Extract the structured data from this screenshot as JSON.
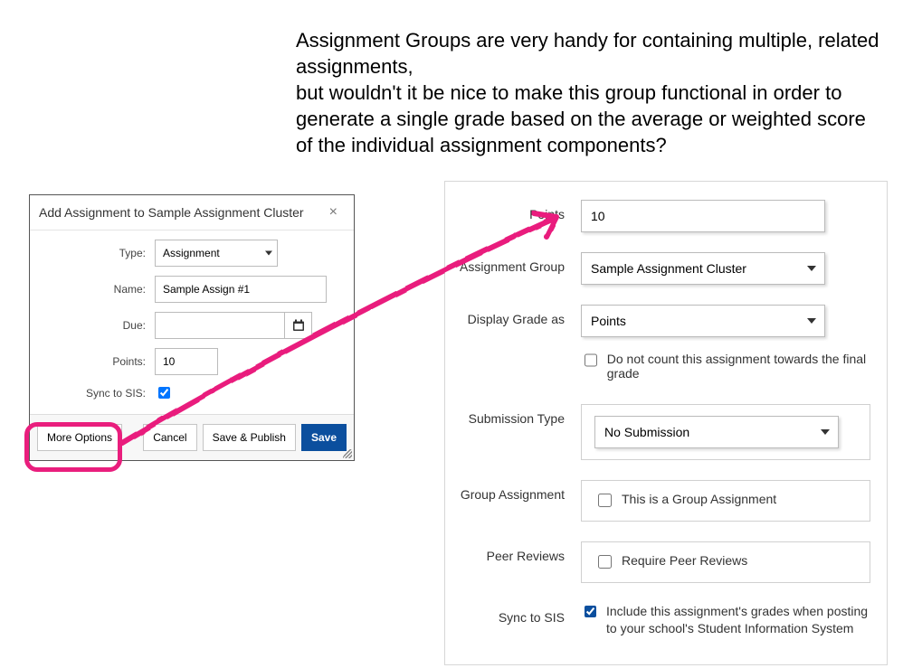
{
  "caption": {
    "line1": "Assignment Groups are very handy for containing multiple, related assignments,",
    "line2": "but wouldn't it be nice to make this group functional in order to generate a single grade based on the average or weighted score of the individual assignment components?"
  },
  "modal": {
    "title": "Add Assignment to Sample Assignment Cluster",
    "close_glyph": "×",
    "labels": {
      "type": "Type:",
      "name": "Name:",
      "due": "Due:",
      "points": "Points:",
      "sync": "Sync to SIS:"
    },
    "fields": {
      "type_value": "Assignment",
      "name_value": "Sample Assign #1",
      "due_value": "",
      "points_value": "10",
      "sync_checked": true
    },
    "buttons": {
      "more_options": "More Options",
      "cancel": "Cancel",
      "save_publish": "Save & Publish",
      "save": "Save"
    }
  },
  "form": {
    "labels": {
      "points": "Points",
      "assignment_group": "Assignment Group",
      "display_grade_as": "Display Grade as",
      "submission_type": "Submission Type",
      "group_assignment": "Group Assignment",
      "peer_reviews": "Peer Reviews",
      "sync_to_sis": "Sync to SIS"
    },
    "values": {
      "points": "10",
      "assignment_group": "Sample Assignment Cluster",
      "display_grade_as": "Points",
      "submission_type": "No Submission"
    },
    "checkboxes": {
      "do_not_count_label": "Do not count this assignment towards the final grade",
      "do_not_count_checked": false,
      "group_label": "This is a Group Assignment",
      "group_checked": false,
      "peer_label": "Require Peer Reviews",
      "peer_checked": false,
      "sis_label": "Include this assignment's grades when posting to your school's Student Information System",
      "sis_checked": true
    }
  },
  "colors": {
    "highlight": "#e91e7d",
    "primary": "#0b4f9e"
  }
}
